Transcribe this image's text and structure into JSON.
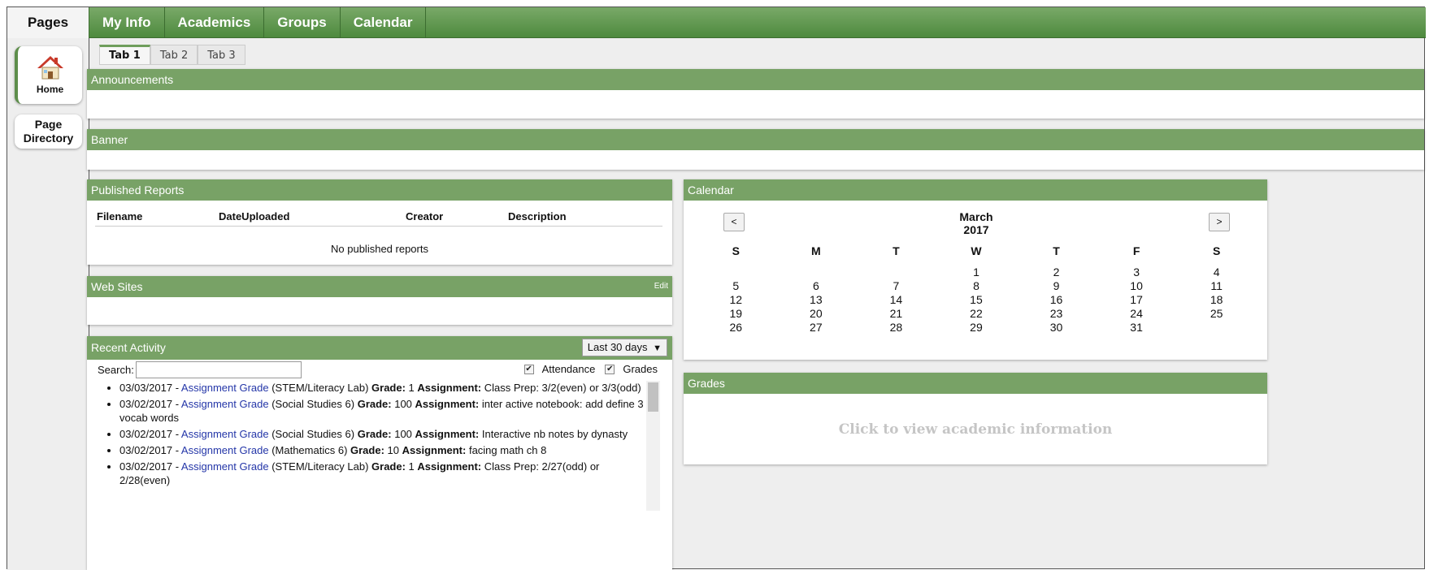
{
  "sidebar": {
    "title": "Pages",
    "home_label": "Home",
    "directory_label": "Page Directory"
  },
  "nav": [
    "My Info",
    "Academics",
    "Groups",
    "Calendar"
  ],
  "tabs": [
    "Tab 1",
    "Tab 2",
    "Tab 3"
  ],
  "announcements": {
    "title": "Announcements"
  },
  "banner": {
    "title": "Banner"
  },
  "reports": {
    "title": "Published Reports",
    "columns": [
      "Filename",
      "DateUploaded",
      "Creator",
      "Description"
    ],
    "empty_text": "No published reports"
  },
  "websites": {
    "title": "Web Sites",
    "edit_label": "Edit"
  },
  "activity": {
    "title": "Recent Activity",
    "range": "Last 30 days",
    "range_arrow": "▼",
    "search_label": "Search:",
    "search_value": "",
    "filter_attendance": "Attendance",
    "filter_grades": "Grades",
    "checkmark": "✔",
    "items": [
      {
        "date": "03/03/2017",
        "sep": " - ",
        "link": "Assignment Grade",
        "course": " (STEM/Literacy Lab) ",
        "grade_label": "Grade:",
        "grade": " 1 ",
        "assign_label": "Assignment:",
        "assignment": " Class Prep: 3/2(even) or 3/3(odd)"
      },
      {
        "date": "03/02/2017",
        "sep": " - ",
        "link": "Assignment Grade",
        "course": " (Social Studies 6) ",
        "grade_label": "Grade:",
        "grade": " 100 ",
        "assign_label": "Assignment:",
        "assignment": " inter active notebook: add define 3 vocab words"
      },
      {
        "date": "03/02/2017",
        "sep": " - ",
        "link": "Assignment Grade",
        "course": " (Social Studies 6) ",
        "grade_label": "Grade:",
        "grade": " 100 ",
        "assign_label": "Assignment:",
        "assignment": " Interactive nb notes by dynasty"
      },
      {
        "date": "03/02/2017",
        "sep": " - ",
        "link": "Assignment Grade",
        "course": " (Mathematics 6) ",
        "grade_label": "Grade:",
        "grade": " 10 ",
        "assign_label": "Assignment:",
        "assignment": " facing math ch 8"
      },
      {
        "date": "03/02/2017",
        "sep": " - ",
        "link": "Assignment Grade",
        "course": " (STEM/Literacy Lab) ",
        "grade_label": "Grade:",
        "grade": " 1 ",
        "assign_label": "Assignment:",
        "assignment": " Class Prep: 2/27(odd) or 2/28(even)"
      }
    ]
  },
  "calendar": {
    "title": "Calendar",
    "month": "March",
    "year": "2017",
    "prev_label": "<",
    "next_label": ">",
    "weekdays": [
      "S",
      "M",
      "T",
      "W",
      "T",
      "F",
      "S"
    ],
    "weeks": [
      [
        "",
        "",
        "",
        "1",
        "2",
        "3",
        "4"
      ],
      [
        "5",
        "6",
        "7",
        "8",
        "9",
        "10",
        "11"
      ],
      [
        "12",
        "13",
        "14",
        "15",
        "16",
        "17",
        "18"
      ],
      [
        "19",
        "20",
        "21",
        "22",
        "23",
        "24",
        "25"
      ],
      [
        "26",
        "27",
        "28",
        "29",
        "30",
        "31",
        ""
      ]
    ]
  },
  "grades": {
    "title": "Grades",
    "link_text": "Click to view academic information"
  },
  "colors": {
    "nav_green": "#5d8e4b",
    "panel_green": "#78a266",
    "link_blue": "#2436a8"
  }
}
